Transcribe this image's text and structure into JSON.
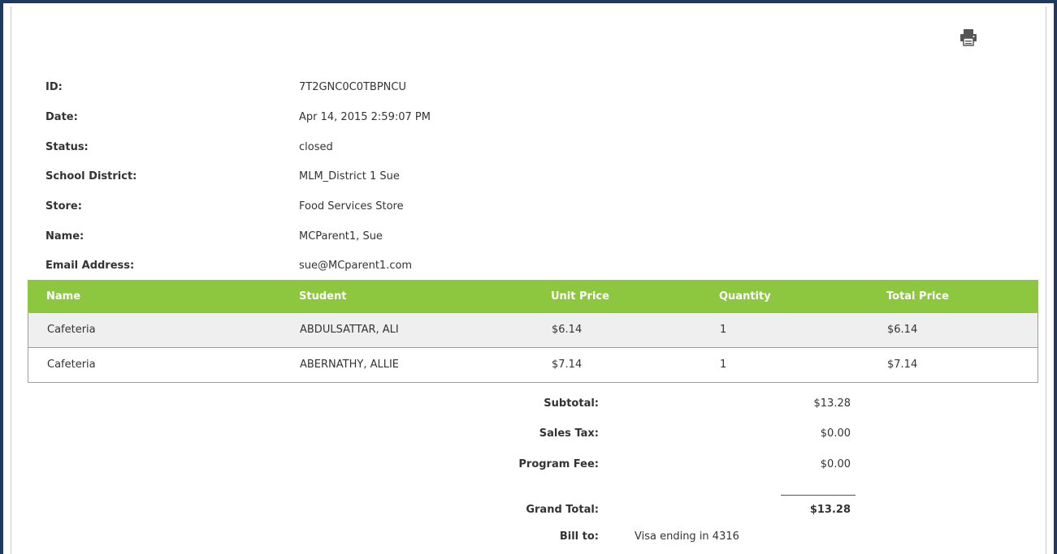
{
  "print_icon": "printer-icon",
  "colors": {
    "table_header": "#8dc63f",
    "frame": "#1f3a5f"
  },
  "details": [
    {
      "label": "ID:",
      "value": "7T2GNC0C0TBPNCU"
    },
    {
      "label": "Date:",
      "value": "Apr 14, 2015 2:59:07 PM"
    },
    {
      "label": "Status:",
      "value": "closed"
    },
    {
      "label": "School District:",
      "value": "MLM_District 1 Sue"
    },
    {
      "label": "Store:",
      "value": "Food Services Store"
    },
    {
      "label": "Name:",
      "value": "MCParent1, Sue"
    },
    {
      "label": "Email Address:",
      "value": "sue@MCparent1.com"
    }
  ],
  "table": {
    "headers": [
      "Name",
      "Student",
      "Unit Price",
      "Quantity",
      "Total Price"
    ],
    "rows": [
      [
        "Cafeteria",
        "ABDULSATTAR, ALI",
        "$6.14",
        "1",
        "$6.14"
      ],
      [
        "Cafeteria",
        "ABERNATHY, ALLIE",
        "$7.14",
        "1",
        "$7.14"
      ]
    ]
  },
  "totals": {
    "subtotal_label": "Subtotal:",
    "subtotal_value": "$13.28",
    "tax_label": "Sales Tax:",
    "tax_value": "$0.00",
    "fee_label": "Program Fee:",
    "fee_value": "$0.00",
    "grand_label": "Grand Total:",
    "grand_value": "$13.28",
    "billto_label": "Bill to:",
    "billto_value": "Visa ending in 4316"
  }
}
